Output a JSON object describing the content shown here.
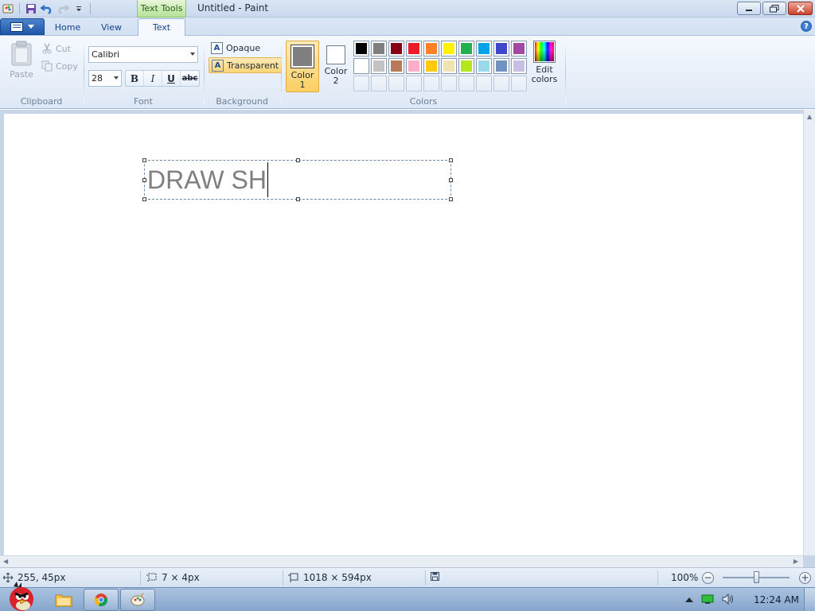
{
  "window": {
    "title": "Untitled - Paint",
    "context_tab": "Text Tools"
  },
  "tabs": [
    {
      "label": "Home",
      "active": false
    },
    {
      "label": "View",
      "active": false
    },
    {
      "label": "Text",
      "active": true
    }
  ],
  "clipboard": {
    "paste_label": "Paste",
    "cut_label": "Cut",
    "copy_label": "Copy",
    "group_label": "Clipboard"
  },
  "font": {
    "family": "Calibri",
    "size": "28",
    "bold_label": "B",
    "italic_label": "I",
    "underline_label": "U",
    "strike_label": "abc",
    "group_label": "Font"
  },
  "background": {
    "opaque_label": "Opaque",
    "transparent_label": "Transparent",
    "selected": "Transparent",
    "group_label": "Background"
  },
  "colors": {
    "color1_label_line1": "Color",
    "color1_label_line2": "1",
    "color1_value": "#7f7f7f",
    "color2_label_line1": "Color",
    "color2_label_line2": "2",
    "color2_value": "#ffffff",
    "palette_row1": [
      "#000000",
      "#7f7f7f",
      "#880015",
      "#ed1c24",
      "#ff7f27",
      "#fff200",
      "#22b14c",
      "#00a2e8",
      "#3f48cc",
      "#a349a4"
    ],
    "palette_row2": [
      "#ffffff",
      "#c3c3c3",
      "#b97a57",
      "#ffaec9",
      "#ffc90e",
      "#efe4b0",
      "#b5e61d",
      "#99d9ea",
      "#7092be",
      "#c8bfe7"
    ],
    "edit_label_line1": "Edit",
    "edit_label_line2": "colors",
    "group_label": "Colors"
  },
  "canvas": {
    "text": "DRAW SH"
  },
  "status": {
    "cursor_pos": "255, 45px",
    "selection_size": "7 × 4px",
    "canvas_size": "1018 × 594px",
    "zoom": "100%"
  },
  "taskbar": {
    "time": "12:24 AM"
  }
}
